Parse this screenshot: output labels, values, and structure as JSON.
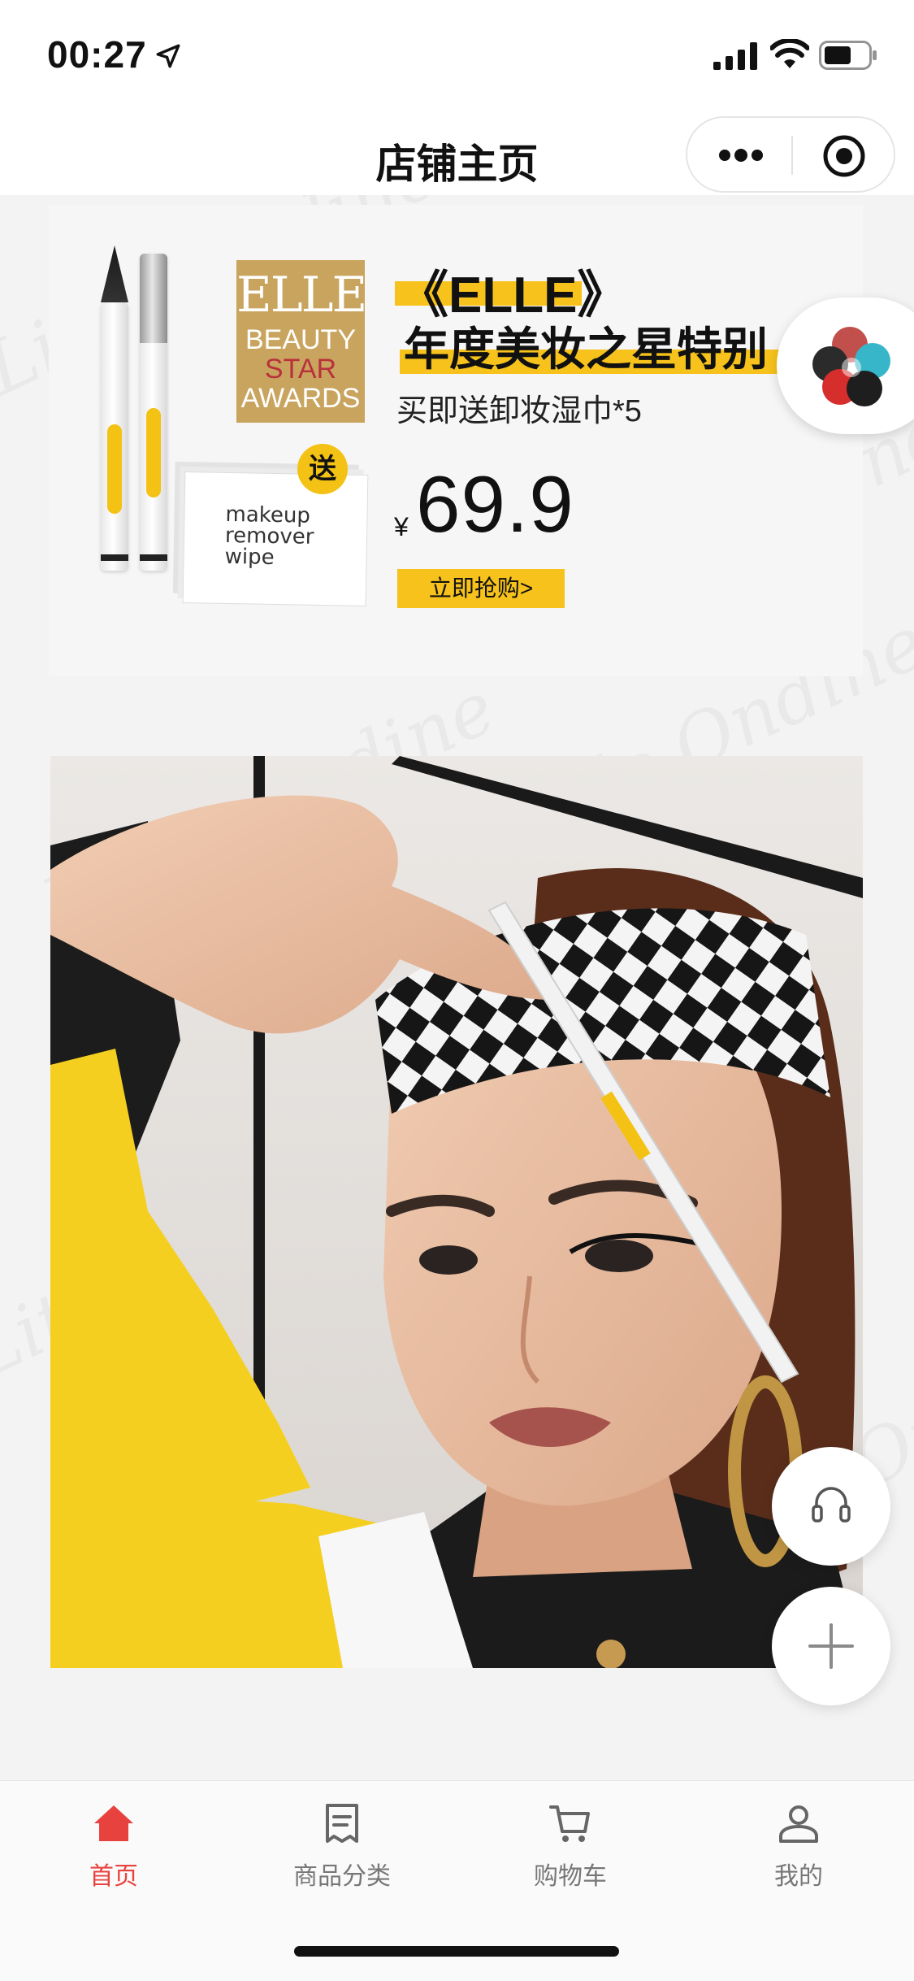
{
  "status_bar": {
    "time": "00:27",
    "icons": [
      "location-arrow-icon",
      "cellular-signal-icon",
      "wifi-icon",
      "battery-icon"
    ]
  },
  "nav": {
    "title": "店铺主页",
    "capsule_icons": [
      "more-dots-icon",
      "close-target-icon"
    ]
  },
  "banner": {
    "brand_mark": [
      "ELLE",
      "BEAUTY",
      "STAR",
      "AWARDS"
    ],
    "headline_1": "《ELLE》",
    "headline_2": "年度美妆之星特别",
    "subtitle": "买即送卸妆湿巾*5",
    "gift_badge": "送",
    "wipes_text": "makeup remover wipe",
    "currency_symbol": "¥",
    "price": "69.9",
    "cta_label": "立即抢购>",
    "accent_color": "#f6c21b"
  },
  "floating_buttons": {
    "service_icon": "headset-icon",
    "add_icon": "plus-icon"
  },
  "tabs": [
    {
      "label": "首页",
      "icon": "home-icon",
      "active": true
    },
    {
      "label": "商品分类",
      "icon": "category-list-icon",
      "active": false
    },
    {
      "label": "购物车",
      "icon": "cart-icon",
      "active": false
    },
    {
      "label": "我的",
      "icon": "user-icon",
      "active": false
    }
  ],
  "colors": {
    "active_tab": "#e8423e",
    "inactive_tab": "#777777",
    "background": "#f3f3f3"
  }
}
